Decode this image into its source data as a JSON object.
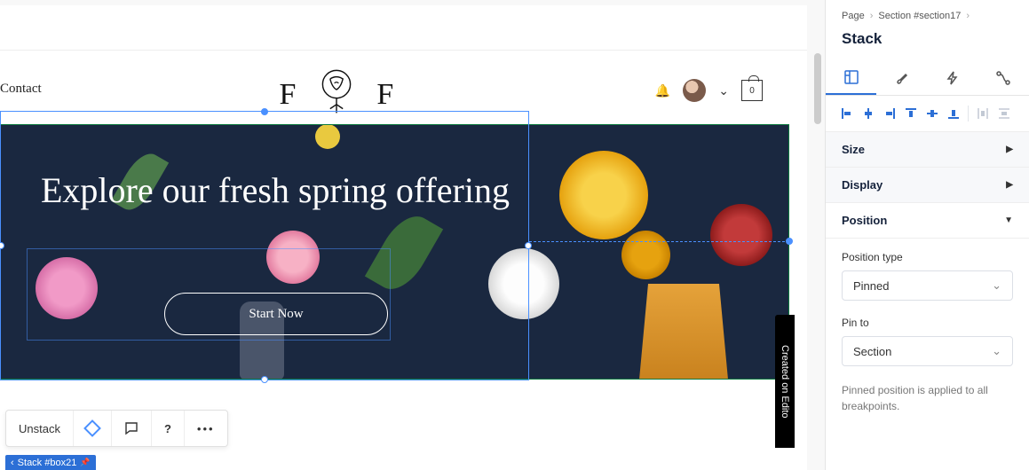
{
  "site": {
    "nav_contact": "Contact",
    "logo_letter": "F",
    "cart_count": "0"
  },
  "hero": {
    "headline": "Explore our fresh spring offering",
    "cta": "Start Now"
  },
  "toolbar": {
    "primary_action": "Unstack"
  },
  "tag": {
    "label": "Stack #box21"
  },
  "badge": {
    "text": "Created on Edito"
  },
  "panel": {
    "breadcrumbs": [
      "Page",
      "Section #section17"
    ],
    "title": "Stack",
    "sections": {
      "size": "Size",
      "display": "Display",
      "position": "Position"
    },
    "position_type": {
      "label": "Position type",
      "value": "Pinned"
    },
    "pin_to": {
      "label": "Pin to",
      "value": "Section"
    },
    "hint": "Pinned position is applied to all breakpoints."
  }
}
